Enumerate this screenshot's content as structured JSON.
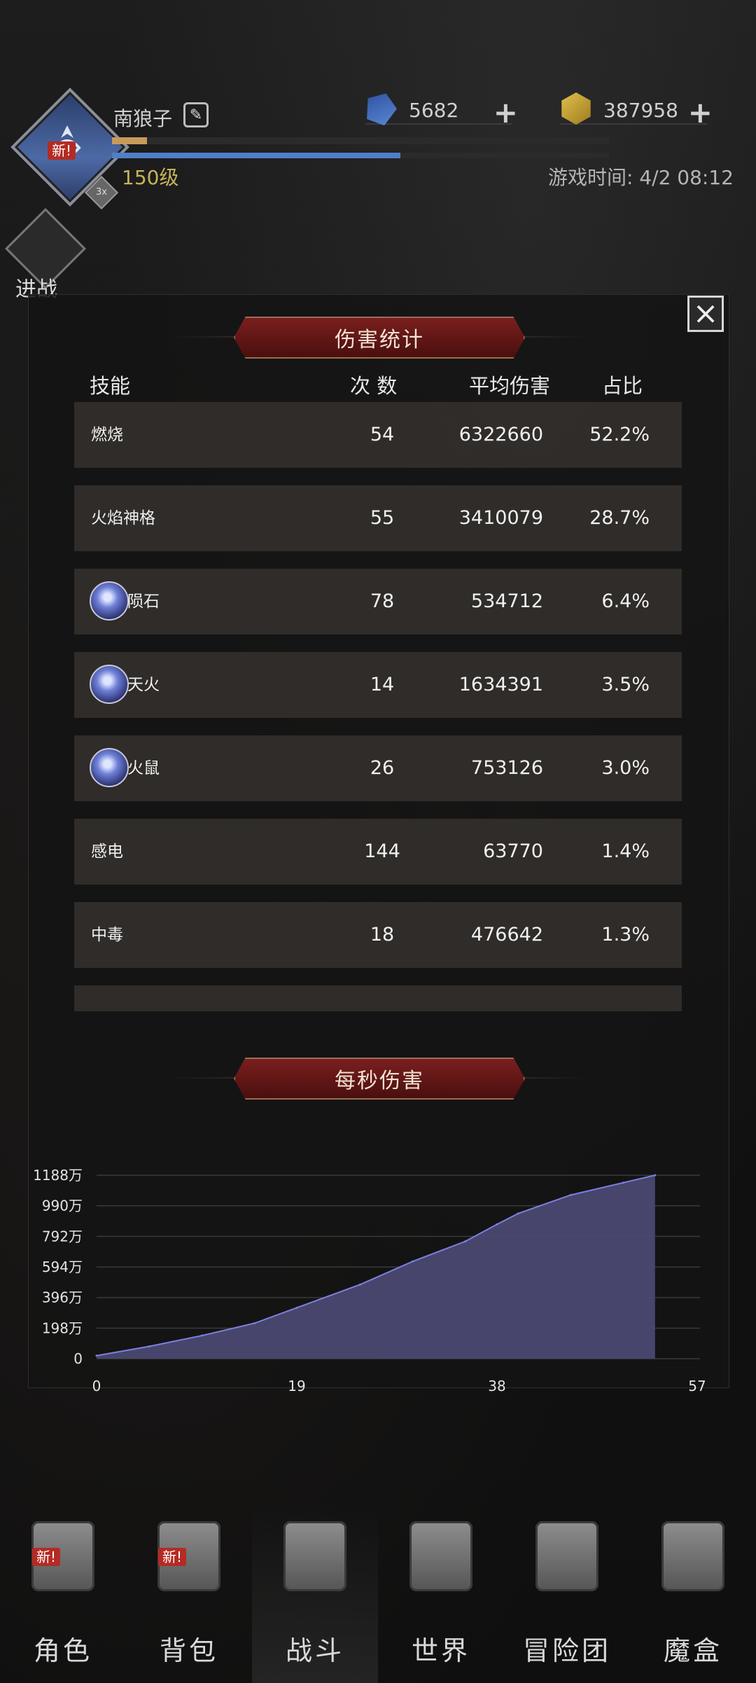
{
  "header": {
    "player_name": "南狼子",
    "player_level": "150级",
    "new_badge": "新!",
    "level_badge": "3x",
    "game_time": "游戏时间: 4/2 08:12",
    "exp_progress": 0.07,
    "hp_progress": 0.58,
    "gems": {
      "value": "5682",
      "icon": "blue-gem-icon"
    },
    "gold": {
      "value": "387958",
      "icon": "gold-ore-icon"
    },
    "side_button_label": "进战"
  },
  "damage_panel": {
    "title": "伤害统计",
    "columns": {
      "skill": "技能",
      "count": "次 数",
      "avg": "平均伤害",
      "pct": "占比"
    },
    "rows": [
      {
        "name": "燃烧",
        "count": "54",
        "avg": "6322660",
        "pct": "52.2%",
        "icon": ""
      },
      {
        "name": "火焰神格",
        "count": "55",
        "avg": "3410079",
        "pct": "28.7%",
        "icon": ""
      },
      {
        "name": "陨石",
        "count": "78",
        "avg": "534712",
        "pct": "6.4%",
        "icon": "meteor-skill-icon"
      },
      {
        "name": "天火",
        "count": "14",
        "avg": "1634391",
        "pct": "3.5%",
        "icon": "sky-fire-skill-icon"
      },
      {
        "name": "火鼠",
        "count": "26",
        "avg": "753126",
        "pct": "3.0%",
        "icon": "fire-rat-skill-icon"
      },
      {
        "name": "感电",
        "count": "144",
        "avg": "63770",
        "pct": "1.4%",
        "icon": ""
      },
      {
        "name": "中毒",
        "count": "18",
        "avg": "476642",
        "pct": "1.3%",
        "icon": ""
      }
    ]
  },
  "dps_panel": {
    "title": "每秒伤害"
  },
  "chart_data": {
    "type": "area",
    "title": "每秒伤害",
    "x": [
      0,
      5,
      10,
      15,
      19,
      25,
      30,
      35,
      38,
      40,
      45,
      50,
      53
    ],
    "y": [
      20,
      80,
      150,
      230,
      330,
      480,
      630,
      760,
      870,
      940,
      1060,
      1140,
      1188
    ],
    "xlim": [
      0,
      57
    ],
    "ylim": [
      0,
      1188
    ],
    "xticks": [
      "0",
      "19",
      "38",
      "57"
    ],
    "xtick_values": [
      0,
      19,
      38,
      57
    ],
    "yticks": [
      "0",
      "198万",
      "396万",
      "594万",
      "792万",
      "990万",
      "1188万"
    ],
    "ytick_values": [
      0,
      198,
      396,
      594,
      792,
      990,
      1188
    ],
    "grid": true,
    "fill_color": "#4a4870",
    "line_color": "#7b80e0"
  },
  "nav": {
    "items": [
      {
        "label": "角色",
        "icon": "helmet-icon",
        "new": "新!"
      },
      {
        "label": "背包",
        "icon": "backpack-icon",
        "new": "新!"
      },
      {
        "label": "战斗",
        "icon": "sword-shield-icon",
        "new": ""
      },
      {
        "label": "世界",
        "icon": "world-map-icon",
        "new": ""
      },
      {
        "label": "冒险团",
        "icon": "castle-icon",
        "new": ""
      },
      {
        "label": "魔盒",
        "icon": "magic-box-icon",
        "new": ""
      }
    ],
    "active_index": 2
  }
}
